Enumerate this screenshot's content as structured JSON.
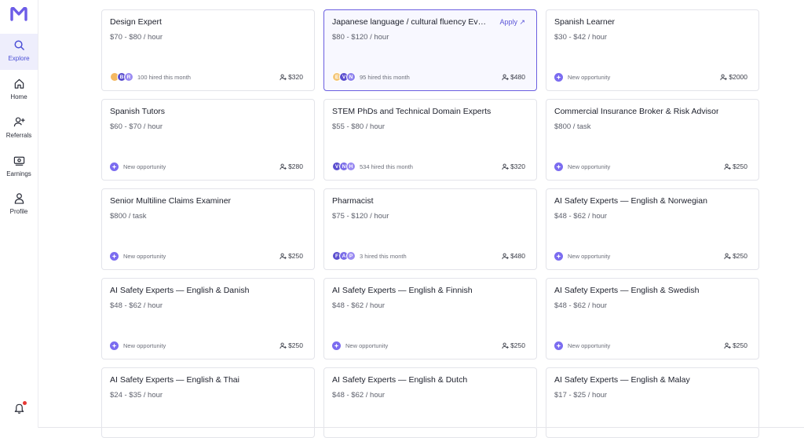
{
  "nav": {
    "items": [
      {
        "label": "Explore",
        "icon": "search-icon",
        "active": true
      },
      {
        "label": "Home",
        "icon": "home-icon",
        "active": false
      },
      {
        "label": "Referrals",
        "icon": "add-person-icon",
        "active": false
      },
      {
        "label": "Earnings",
        "icon": "banknote-icon",
        "active": false
      },
      {
        "label": "Profile",
        "icon": "person-icon",
        "active": false
      }
    ],
    "notification_icon": "bell-icon",
    "brand_color": "#6c5ce7"
  },
  "cards": [
    {
      "title": "Design Expert",
      "price": "$70 - $80 / hour",
      "avatars": [
        "",
        "B",
        "R"
      ],
      "avatar_colors": [
        "#f4b860",
        "#5b4fcf",
        "#9b8cf2"
      ],
      "meta": "100 hired this month",
      "bonus": "$320"
    },
    {
      "title": "Japanese language / cultural fluency Eva...",
      "price": "$80 - $120 / hour",
      "apply": "Apply ↗",
      "selected": true,
      "avatars": [
        "E",
        "V",
        "N"
      ],
      "avatar_colors": [
        "#f4c77a",
        "#5b4fcf",
        "#8f83ee"
      ],
      "meta": "95 hired this month",
      "bonus": "$480"
    },
    {
      "title": "Spanish Learner",
      "price": "$30 - $42 / hour",
      "meta": "New opportunity",
      "bonus": "$2000"
    },
    {
      "title": "Spanish Tutors",
      "price": "$60 - $70 / hour",
      "meta": "New opportunity",
      "bonus": "$280"
    },
    {
      "title": "STEM PhDs and Technical Domain Experts",
      "price": "$55 - $80 / hour",
      "avatars": [
        "V",
        "N",
        "H"
      ],
      "avatar_colors": [
        "#5b4fcf",
        "#7a6de8",
        "#9b8cf2"
      ],
      "meta": "534 hired this month",
      "bonus": "$320"
    },
    {
      "title": "Commercial Insurance Broker & Risk Advisor",
      "price": "$800 / task",
      "meta": "New opportunity",
      "bonus": "$250"
    },
    {
      "title": "Senior Multiline Claims Examiner",
      "price": "$800 / task",
      "meta": "New opportunity",
      "bonus": "$250"
    },
    {
      "title": "Pharmacist",
      "price": "$75 - $120 / hour",
      "avatars": [
        "F",
        "A",
        "P"
      ],
      "avatar_colors": [
        "#5b4fcf",
        "#7a6de8",
        "#9b8cf2"
      ],
      "meta": "3 hired this month",
      "bonus": "$480"
    },
    {
      "title": "AI Safety Experts — English & Norwegian",
      "price": "$48 - $62 / hour",
      "meta": "New opportunity",
      "bonus": "$250"
    },
    {
      "title": "AI Safety Experts — English & Danish",
      "price": "$48 - $62 / hour",
      "meta": "New opportunity",
      "bonus": "$250"
    },
    {
      "title": "AI Safety Experts — English & Finnish",
      "price": "$48 - $62 / hour",
      "meta": "New opportunity",
      "bonus": "$250"
    },
    {
      "title": "AI Safety Experts — English & Swedish",
      "price": "$48 - $62 / hour",
      "meta": "New opportunity",
      "bonus": "$250"
    },
    {
      "title": "AI Safety Experts — English & Thai",
      "price": "$24 - $35 / hour"
    },
    {
      "title": "AI Safety Experts — English & Dutch",
      "price": "$48 - $62 / hour"
    },
    {
      "title": "AI Safety Experts — English & Malay",
      "price": "$17 - $25 / hour"
    }
  ]
}
